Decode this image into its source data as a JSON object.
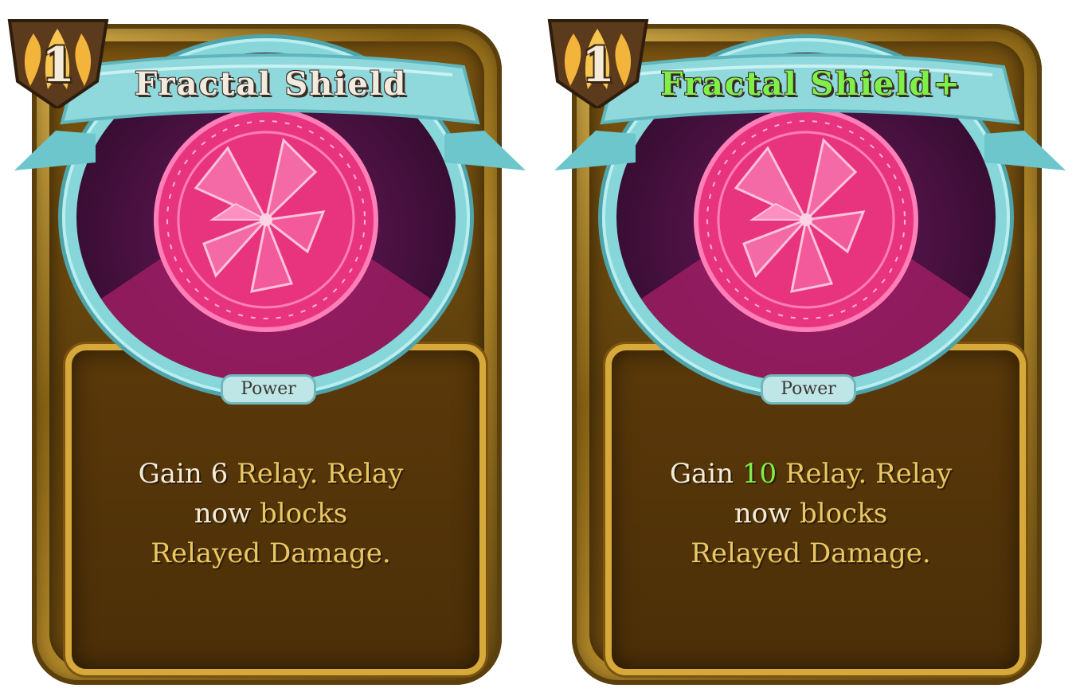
{
  "cards": [
    {
      "name": "Fractal Shield",
      "cost": "1",
      "type": "Power",
      "upgraded": false,
      "description": {
        "gain": "Gain",
        "amount": "6",
        "keyword1": "Relay.",
        "keyword2": "Relay",
        "now": "now",
        "keyword3": "blocks",
        "keyword4": "Relayed Damage."
      }
    },
    {
      "name": "Fractal Shield+",
      "cost": "1",
      "type": "Power",
      "upgraded": true,
      "description": {
        "gain": "Gain",
        "amount": "10",
        "keyword1": "Relay.",
        "keyword2": "Relay",
        "now": "now",
        "keyword3": "blocks",
        "keyword4": "Relayed Damage."
      }
    }
  ],
  "colors": {
    "frame_gold": "#b48a2a",
    "banner_cyan": "#8fd8dc",
    "keyword_gold": "#e9c864",
    "upgrade_green": "#7ff04a",
    "art_magenta": "#e8347f"
  },
  "icons": {
    "energy": "energy-orb-icon",
    "art": "fractal-shield-sigil-icon"
  }
}
